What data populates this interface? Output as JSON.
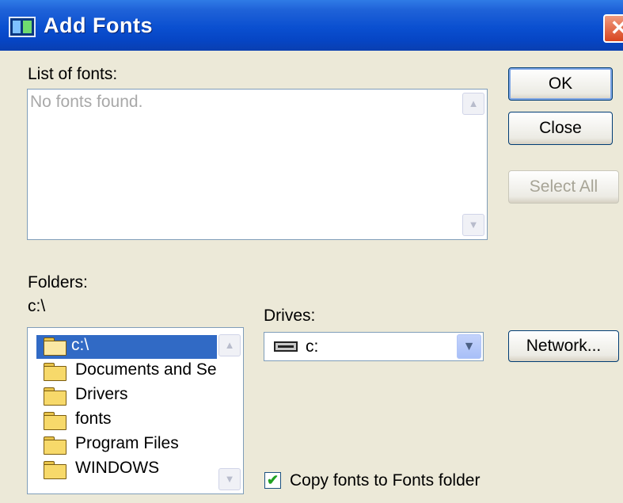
{
  "window": {
    "title": "Add Fonts",
    "close_glyph": "✕"
  },
  "fonts_list": {
    "label": "List of fonts:",
    "empty_text": "No fonts found."
  },
  "buttons": {
    "ok": "OK",
    "close": "Close",
    "select_all": "Select All",
    "network": "Network..."
  },
  "folders": {
    "label": "Folders:",
    "current_path": "c:\\",
    "items": [
      {
        "label": "c:\\",
        "icon": "open-folder-icon",
        "selected": true
      },
      {
        "label": "Documents and Se",
        "icon": "folder-icon"
      },
      {
        "label": "Drivers",
        "icon": "folder-icon"
      },
      {
        "label": "fonts",
        "icon": "folder-icon"
      },
      {
        "label": "Program Files",
        "icon": "folder-icon"
      },
      {
        "label": "WINDOWS",
        "icon": "folder-icon"
      }
    ]
  },
  "drives": {
    "label": "Drives:",
    "selected": "c:",
    "icon": "drive-icon"
  },
  "copy_option": {
    "label": "Copy fonts to Fonts folder",
    "checked": true
  },
  "colors": {
    "titlebar": "#0a4fd0",
    "selection": "#316ac5",
    "face": "#ece9d8"
  }
}
